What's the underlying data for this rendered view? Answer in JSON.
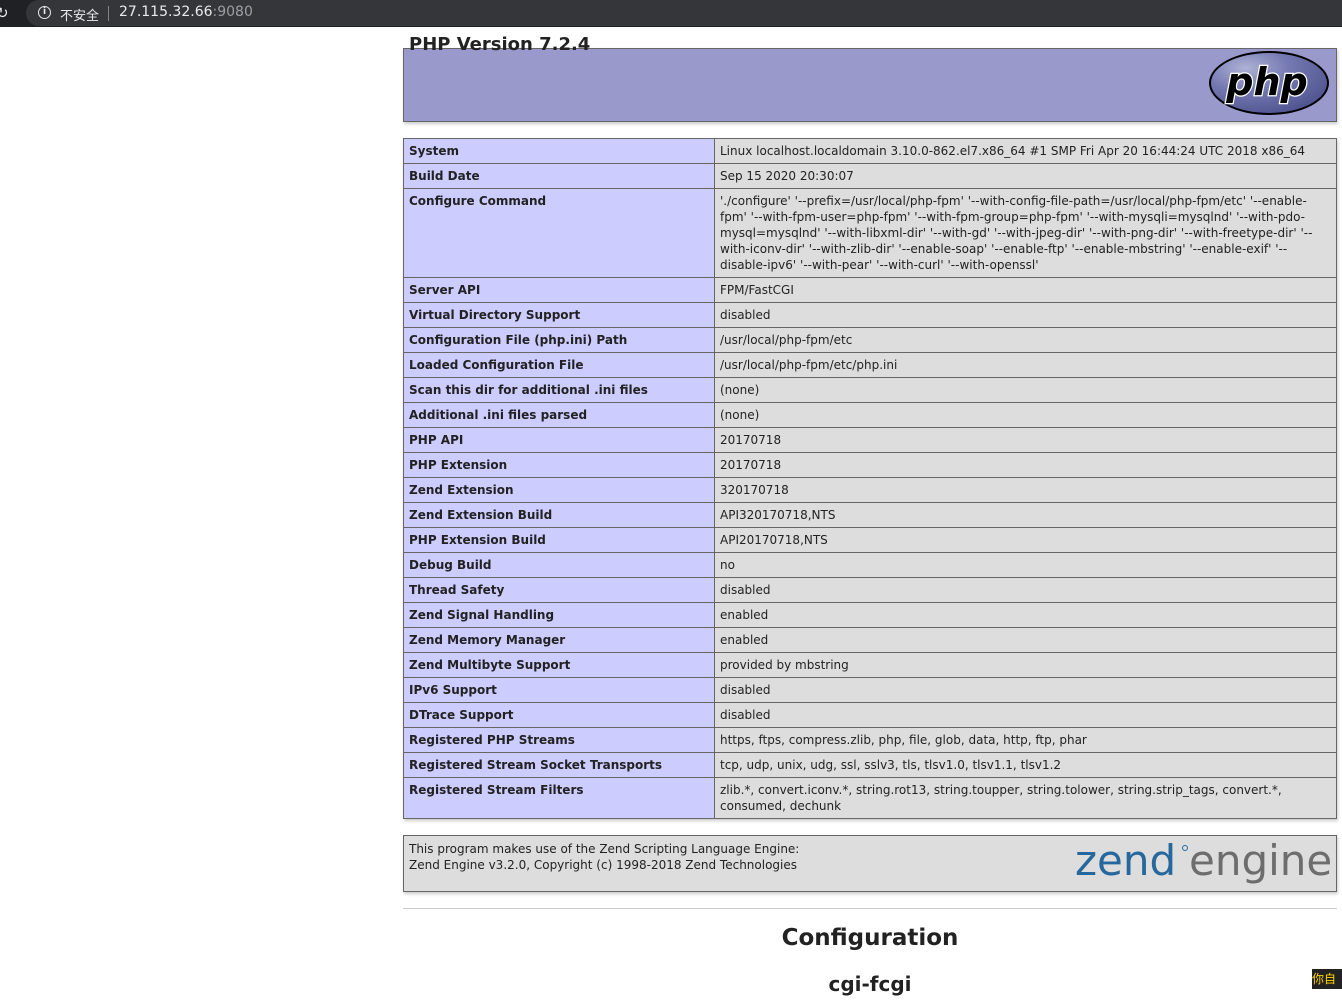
{
  "browser": {
    "security_label": "不安全",
    "url_host": "27.115.32.66",
    "url_port": ":9080"
  },
  "header": {
    "title": "PHP Version 7.2.4",
    "logo_text": "php"
  },
  "info_rows": [
    {
      "key": "System",
      "value": "Linux localhost.localdomain 3.10.0-862.el7.x86_64 #1 SMP Fri Apr 20 16:44:24 UTC 2018 x86_64"
    },
    {
      "key": "Build Date",
      "value": "Sep 15 2020 20:30:07"
    },
    {
      "key": "Configure Command",
      "value": "'./configure' '--prefix=/usr/local/php-fpm' '--with-config-file-path=/usr/local/php-fpm/etc' '--enable-fpm' '--with-fpm-user=php-fpm' '--with-fpm-group=php-fpm' '--with-mysqli=mysqlnd' '--with-pdo-mysql=mysqlnd' '--with-libxml-dir' '--with-gd' '--with-jpeg-dir' '--with-png-dir' '--with-freetype-dir' '--with-iconv-dir' '--with-zlib-dir' '--enable-soap' '--enable-ftp' '--enable-mbstring' '--enable-exif' '--disable-ipv6' '--with-pear' '--with-curl' '--with-openssl'"
    },
    {
      "key": "Server API",
      "value": "FPM/FastCGI"
    },
    {
      "key": "Virtual Directory Support",
      "value": "disabled"
    },
    {
      "key": "Configuration File (php.ini) Path",
      "value": "/usr/local/php-fpm/etc"
    },
    {
      "key": "Loaded Configuration File",
      "value": "/usr/local/php-fpm/etc/php.ini"
    },
    {
      "key": "Scan this dir for additional .ini files",
      "value": "(none)"
    },
    {
      "key": "Additional .ini files parsed",
      "value": "(none)"
    },
    {
      "key": "PHP API",
      "value": "20170718"
    },
    {
      "key": "PHP Extension",
      "value": "20170718"
    },
    {
      "key": "Zend Extension",
      "value": "320170718"
    },
    {
      "key": "Zend Extension Build",
      "value": "API320170718,NTS"
    },
    {
      "key": "PHP Extension Build",
      "value": "API20170718,NTS"
    },
    {
      "key": "Debug Build",
      "value": "no"
    },
    {
      "key": "Thread Safety",
      "value": "disabled"
    },
    {
      "key": "Zend Signal Handling",
      "value": "enabled"
    },
    {
      "key": "Zend Memory Manager",
      "value": "enabled"
    },
    {
      "key": "Zend Multibyte Support",
      "value": "provided by mbstring"
    },
    {
      "key": "IPv6 Support",
      "value": "disabled"
    },
    {
      "key": "DTrace Support",
      "value": "disabled"
    },
    {
      "key": "Registered PHP Streams",
      "value": "https, ftps, compress.zlib, php, file, glob, data, http, ftp, phar"
    },
    {
      "key": "Registered Stream Socket Transports",
      "value": "tcp, udp, unix, udg, ssl, sslv3, tls, tlsv1.0, tlsv1.1, tlsv1.2"
    },
    {
      "key": "Registered Stream Filters",
      "value": "zlib.*, convert.iconv.*, string.rot13, string.toupper, string.tolower, string.strip_tags, convert.*, consumed, dechunk"
    }
  ],
  "zend": {
    "line1": "This program makes use of the Zend Scripting Language Engine:",
    "line2": "Zend Engine v3.2.0, Copyright (c) 1998-2018 Zend Technologies",
    "logo_zend": "zend",
    "logo_engine": "engine"
  },
  "sections": {
    "configuration": "Configuration",
    "first_module": "cgi-fcgi"
  },
  "overlay": {
    "corner_text": "你自"
  },
  "colors": {
    "header_bg": "#9999cc",
    "key_bg": "#ccccff",
    "value_bg": "#dddddd",
    "zend_blue": "#26689e",
    "zend_gray": "#6d6d6d"
  }
}
